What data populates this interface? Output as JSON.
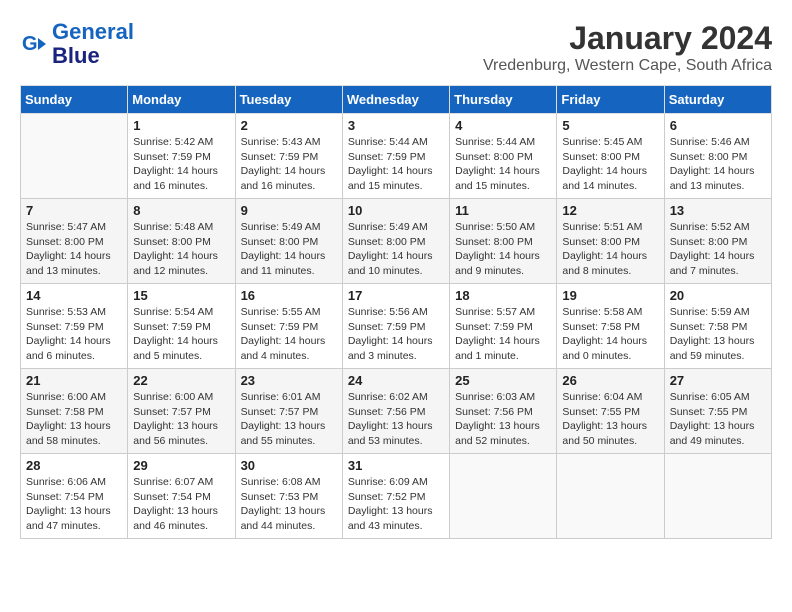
{
  "logo": {
    "line1": "General",
    "line2": "Blue"
  },
  "title": "January 2024",
  "location": "Vredenburg, Western Cape, South Africa",
  "days_of_week": [
    "Sunday",
    "Monday",
    "Tuesday",
    "Wednesday",
    "Thursday",
    "Friday",
    "Saturday"
  ],
  "weeks": [
    [
      {
        "day": "",
        "info": ""
      },
      {
        "day": "1",
        "info": "Sunrise: 5:42 AM\nSunset: 7:59 PM\nDaylight: 14 hours\nand 16 minutes."
      },
      {
        "day": "2",
        "info": "Sunrise: 5:43 AM\nSunset: 7:59 PM\nDaylight: 14 hours\nand 16 minutes."
      },
      {
        "day": "3",
        "info": "Sunrise: 5:44 AM\nSunset: 7:59 PM\nDaylight: 14 hours\nand 15 minutes."
      },
      {
        "day": "4",
        "info": "Sunrise: 5:44 AM\nSunset: 8:00 PM\nDaylight: 14 hours\nand 15 minutes."
      },
      {
        "day": "5",
        "info": "Sunrise: 5:45 AM\nSunset: 8:00 PM\nDaylight: 14 hours\nand 14 minutes."
      },
      {
        "day": "6",
        "info": "Sunrise: 5:46 AM\nSunset: 8:00 PM\nDaylight: 14 hours\nand 13 minutes."
      }
    ],
    [
      {
        "day": "7",
        "info": "Sunrise: 5:47 AM\nSunset: 8:00 PM\nDaylight: 14 hours\nand 13 minutes."
      },
      {
        "day": "8",
        "info": "Sunrise: 5:48 AM\nSunset: 8:00 PM\nDaylight: 14 hours\nand 12 minutes."
      },
      {
        "day": "9",
        "info": "Sunrise: 5:49 AM\nSunset: 8:00 PM\nDaylight: 14 hours\nand 11 minutes."
      },
      {
        "day": "10",
        "info": "Sunrise: 5:49 AM\nSunset: 8:00 PM\nDaylight: 14 hours\nand 10 minutes."
      },
      {
        "day": "11",
        "info": "Sunrise: 5:50 AM\nSunset: 8:00 PM\nDaylight: 14 hours\nand 9 minutes."
      },
      {
        "day": "12",
        "info": "Sunrise: 5:51 AM\nSunset: 8:00 PM\nDaylight: 14 hours\nand 8 minutes."
      },
      {
        "day": "13",
        "info": "Sunrise: 5:52 AM\nSunset: 8:00 PM\nDaylight: 14 hours\nand 7 minutes."
      }
    ],
    [
      {
        "day": "14",
        "info": "Sunrise: 5:53 AM\nSunset: 7:59 PM\nDaylight: 14 hours\nand 6 minutes."
      },
      {
        "day": "15",
        "info": "Sunrise: 5:54 AM\nSunset: 7:59 PM\nDaylight: 14 hours\nand 5 minutes."
      },
      {
        "day": "16",
        "info": "Sunrise: 5:55 AM\nSunset: 7:59 PM\nDaylight: 14 hours\nand 4 minutes."
      },
      {
        "day": "17",
        "info": "Sunrise: 5:56 AM\nSunset: 7:59 PM\nDaylight: 14 hours\nand 3 minutes."
      },
      {
        "day": "18",
        "info": "Sunrise: 5:57 AM\nSunset: 7:59 PM\nDaylight: 14 hours\nand 1 minute."
      },
      {
        "day": "19",
        "info": "Sunrise: 5:58 AM\nSunset: 7:58 PM\nDaylight: 14 hours\nand 0 minutes."
      },
      {
        "day": "20",
        "info": "Sunrise: 5:59 AM\nSunset: 7:58 PM\nDaylight: 13 hours\nand 59 minutes."
      }
    ],
    [
      {
        "day": "21",
        "info": "Sunrise: 6:00 AM\nSunset: 7:58 PM\nDaylight: 13 hours\nand 58 minutes."
      },
      {
        "day": "22",
        "info": "Sunrise: 6:00 AM\nSunset: 7:57 PM\nDaylight: 13 hours\nand 56 minutes."
      },
      {
        "day": "23",
        "info": "Sunrise: 6:01 AM\nSunset: 7:57 PM\nDaylight: 13 hours\nand 55 minutes."
      },
      {
        "day": "24",
        "info": "Sunrise: 6:02 AM\nSunset: 7:56 PM\nDaylight: 13 hours\nand 53 minutes."
      },
      {
        "day": "25",
        "info": "Sunrise: 6:03 AM\nSunset: 7:56 PM\nDaylight: 13 hours\nand 52 minutes."
      },
      {
        "day": "26",
        "info": "Sunrise: 6:04 AM\nSunset: 7:55 PM\nDaylight: 13 hours\nand 50 minutes."
      },
      {
        "day": "27",
        "info": "Sunrise: 6:05 AM\nSunset: 7:55 PM\nDaylight: 13 hours\nand 49 minutes."
      }
    ],
    [
      {
        "day": "28",
        "info": "Sunrise: 6:06 AM\nSunset: 7:54 PM\nDaylight: 13 hours\nand 47 minutes."
      },
      {
        "day": "29",
        "info": "Sunrise: 6:07 AM\nSunset: 7:54 PM\nDaylight: 13 hours\nand 46 minutes."
      },
      {
        "day": "30",
        "info": "Sunrise: 6:08 AM\nSunset: 7:53 PM\nDaylight: 13 hours\nand 44 minutes."
      },
      {
        "day": "31",
        "info": "Sunrise: 6:09 AM\nSunset: 7:52 PM\nDaylight: 13 hours\nand 43 minutes."
      },
      {
        "day": "",
        "info": ""
      },
      {
        "day": "",
        "info": ""
      },
      {
        "day": "",
        "info": ""
      }
    ]
  ]
}
